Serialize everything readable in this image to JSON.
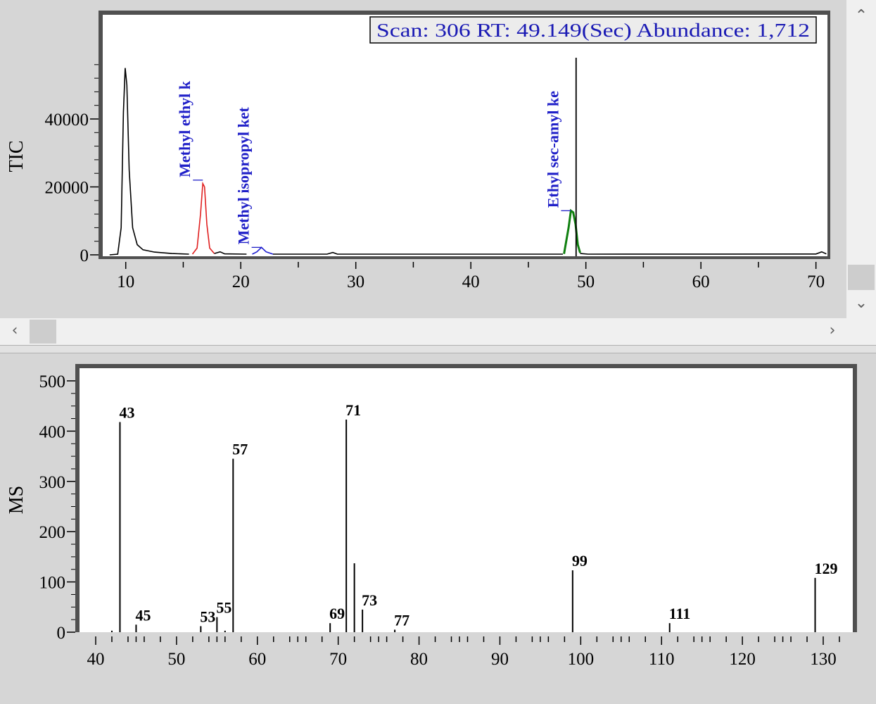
{
  "tic_chart": {
    "ylabel": "TIC",
    "readout": "Scan: 306  RT: 49.149(Sec)  Abundance: 1,712",
    "xlim": [
      8,
      71
    ],
    "ylim": [
      0,
      64000
    ],
    "x_ticks": [
      10,
      20,
      30,
      40,
      50,
      60,
      70
    ],
    "y_ticks": [
      0,
      20000,
      40000
    ],
    "cursor_rt": 49.15,
    "peaks": [
      {
        "color": "#000000",
        "points": [
          [
            8.6,
            0
          ],
          [
            9.3,
            200
          ],
          [
            9.6,
            8000
          ],
          [
            9.8,
            42000
          ],
          [
            9.95,
            55000
          ],
          [
            10.1,
            50000
          ],
          [
            10.3,
            25000
          ],
          [
            10.6,
            8000
          ],
          [
            11,
            3000
          ],
          [
            11.5,
            1500
          ],
          [
            12.5,
            800
          ],
          [
            14,
            400
          ],
          [
            15.5,
            200
          ]
        ]
      },
      {
        "color": "#e02020",
        "points": [
          [
            15.8,
            200
          ],
          [
            16.2,
            2000
          ],
          [
            16.5,
            12000
          ],
          [
            16.7,
            21000
          ],
          [
            16.85,
            20000
          ],
          [
            17.05,
            9000
          ],
          [
            17.3,
            2000
          ],
          [
            17.7,
            400
          ]
        ]
      },
      {
        "color": "#000000",
        "points": [
          [
            17.7,
            400
          ],
          [
            18.2,
            900
          ],
          [
            18.6,
            300
          ],
          [
            20.5,
            200
          ]
        ]
      },
      {
        "color": "#2020d0",
        "points": [
          [
            21.0,
            200
          ],
          [
            21.4,
            900
          ],
          [
            21.8,
            2200
          ],
          [
            22.2,
            900
          ],
          [
            22.8,
            200
          ]
        ]
      },
      {
        "color": "#000000",
        "points": [
          [
            22.8,
            200
          ],
          [
            27.5,
            200
          ],
          [
            28.0,
            700
          ],
          [
            28.4,
            200
          ],
          [
            48.0,
            200
          ]
        ]
      },
      {
        "color": "#108010",
        "points": [
          [
            48.1,
            300
          ],
          [
            48.5,
            8000
          ],
          [
            48.7,
            13000
          ],
          [
            48.9,
            12500
          ],
          [
            49.1,
            9000
          ],
          [
            49.3,
            3000
          ],
          [
            49.5,
            600
          ]
        ]
      },
      {
        "color": "#000000",
        "points": [
          [
            49.5,
            400
          ],
          [
            50.2,
            200
          ],
          [
            70.0,
            250
          ],
          [
            70.5,
            900
          ],
          [
            70.9,
            300
          ]
        ]
      }
    ],
    "annotations": [
      {
        "text": "Methyl ethyl k",
        "rt": 16.7,
        "abundance": 22000,
        "color": "#2020c8"
      },
      {
        "text": "Methyl isopropyl ket",
        "rt": 21.8,
        "abundance": 2200,
        "color": "#2020c8"
      },
      {
        "text": "Ethyl sec-amyl ke",
        "rt": 48.7,
        "abundance": 13000,
        "color": "#2020c8"
      }
    ]
  },
  "ms_chart": {
    "ylabel": "MS",
    "xlim": [
      38,
      133
    ],
    "ylim": [
      0,
      520
    ],
    "x_ticks": [
      40,
      50,
      60,
      70,
      80,
      90,
      100,
      110,
      120,
      130
    ],
    "y_ticks": [
      0,
      100,
      200,
      300,
      400,
      500
    ],
    "peaks": [
      {
        "mz": 42,
        "abundance": 3,
        "label": ""
      },
      {
        "mz": 43,
        "abundance": 418,
        "label": "43"
      },
      {
        "mz": 45,
        "abundance": 15,
        "label": "45"
      },
      {
        "mz": 53,
        "abundance": 12,
        "label": "53"
      },
      {
        "mz": 55,
        "abundance": 30,
        "label": "55"
      },
      {
        "mz": 56,
        "abundance": 3,
        "label": ""
      },
      {
        "mz": 57,
        "abundance": 345,
        "label": "57"
      },
      {
        "mz": 69,
        "abundance": 18,
        "label": "69"
      },
      {
        "mz": 71,
        "abundance": 423,
        "label": "71"
      },
      {
        "mz": 72,
        "abundance": 137,
        "label": ""
      },
      {
        "mz": 73,
        "abundance": 45,
        "label": "73"
      },
      {
        "mz": 77,
        "abundance": 5,
        "label": "77"
      },
      {
        "mz": 99,
        "abundance": 123,
        "label": "99"
      },
      {
        "mz": 111,
        "abundance": 18,
        "label": "111"
      },
      {
        "mz": 129,
        "abundance": 108,
        "label": "129"
      }
    ]
  },
  "scrollbars": {
    "up_icon": "chevron-up-icon",
    "down_icon": "chevron-down-icon",
    "left_icon": "chevron-left-icon",
    "right_icon": "chevron-right-icon"
  }
}
